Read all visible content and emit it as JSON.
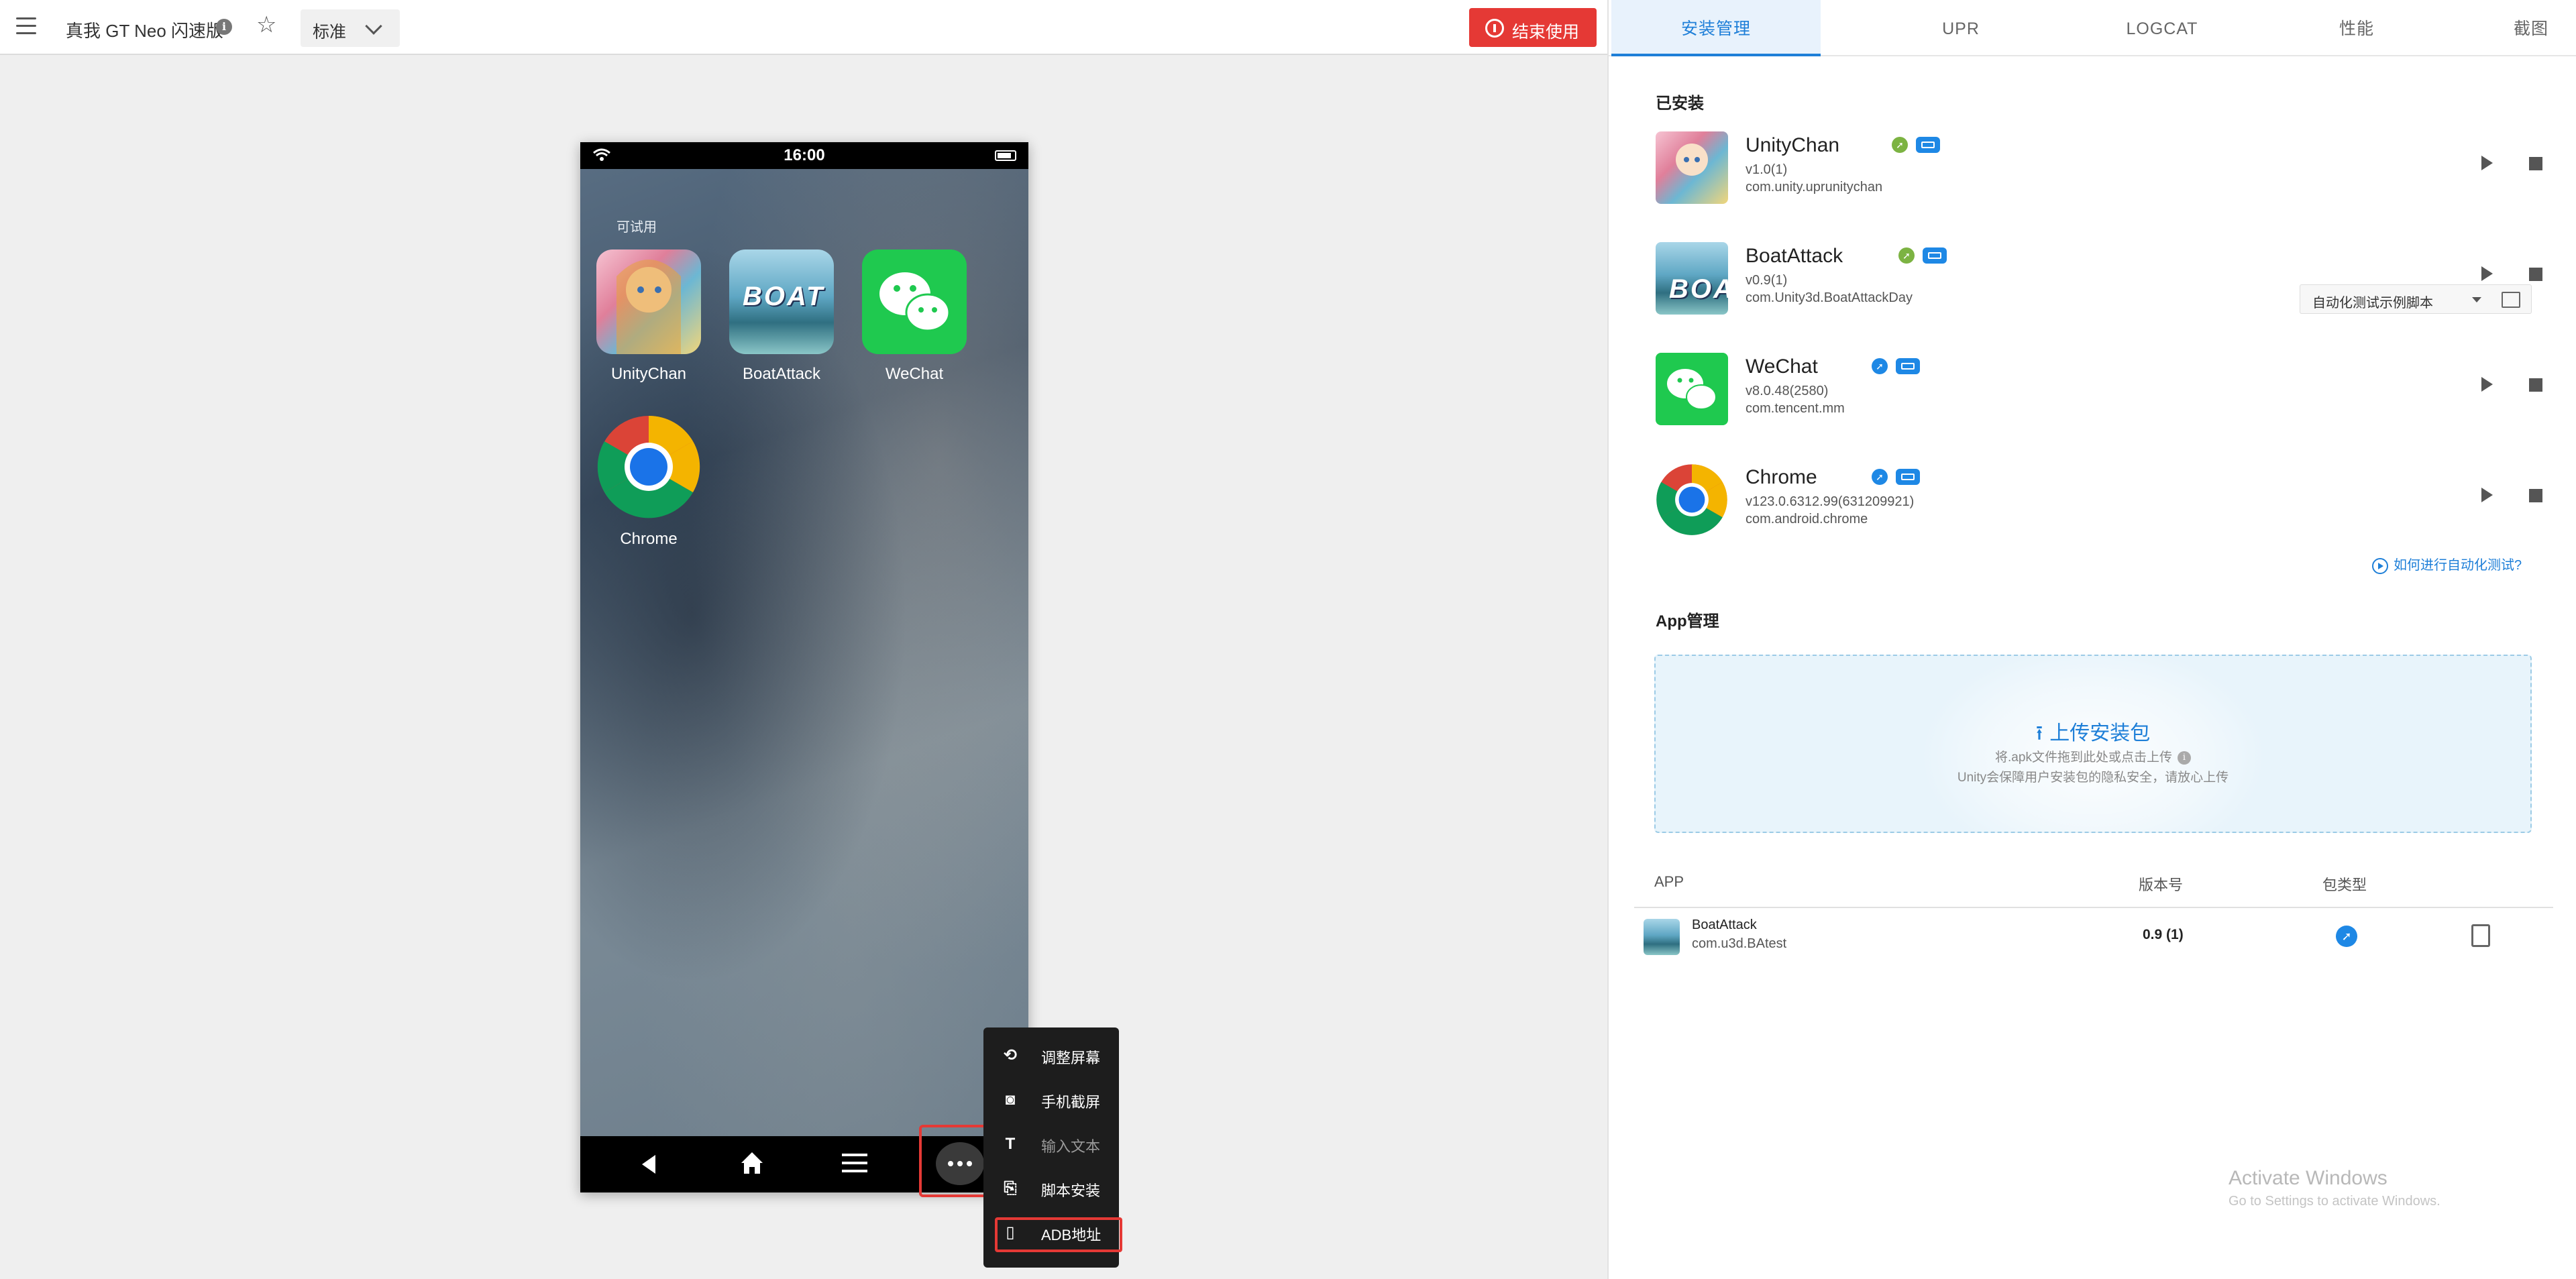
{
  "topbar": {
    "device_name": "真我 GT Neo 闪速版",
    "mode": "标准",
    "end_label": "结束使用"
  },
  "phone": {
    "time": "16:00",
    "section_label": "可试用",
    "apps": [
      {
        "name": "UnityChan"
      },
      {
        "name": "BoatAttack"
      },
      {
        "name": "WeChat"
      },
      {
        "name": "Chrome"
      }
    ]
  },
  "float_menu": {
    "items": [
      {
        "label": "调整屏幕",
        "icon": "rotate-screen-icon"
      },
      {
        "label": "手机截屏",
        "icon": "camera-icon"
      },
      {
        "label": "输入文本",
        "icon": "text-icon"
      },
      {
        "label": "脚本安装",
        "icon": "script-install-icon"
      },
      {
        "label": "ADB地址",
        "icon": "phone-icon"
      }
    ]
  },
  "tabs": [
    "安装管理",
    "UPR",
    "LOGCAT",
    "性能",
    "截图"
  ],
  "installed": {
    "title": "已安装",
    "apps": [
      {
        "name": "UnityChan",
        "version": "v1.0(1)",
        "package": "com.unity.uprunitychan"
      },
      {
        "name": "BoatAttack",
        "version": "v0.9(1)",
        "package": "com.Unity3d.BoatAttackDay"
      },
      {
        "name": "WeChat",
        "version": "v8.0.48(2580)",
        "package": "com.tencent.mm"
      },
      {
        "name": "Chrome",
        "version": "v123.0.6312.99(631209921)",
        "package": "com.android.chrome"
      }
    ],
    "script_select": "自动化测试示例脚本",
    "howto_link": "如何进行自动化测试?"
  },
  "app_mgmt": {
    "title": "App管理",
    "upload_title": "上传安装包",
    "upload_hint1": "将.apk文件拖到此处或点击上传",
    "upload_hint2": "Unity会保障用户安装包的隐私安全，请放心上传",
    "table": {
      "headers": [
        "APP",
        "版本号",
        "包类型"
      ],
      "rows": [
        {
          "name": "BoatAttack",
          "package": "com.u3d.BAtest",
          "version": "0.9 (1)"
        }
      ]
    }
  },
  "watermark": {
    "line1": "Activate Windows",
    "line2": "Go to Settings to activate Windows."
  },
  "colors": {
    "accent": "#1e7fd8",
    "danger": "#e53935",
    "wechat": "#1fc94f"
  }
}
